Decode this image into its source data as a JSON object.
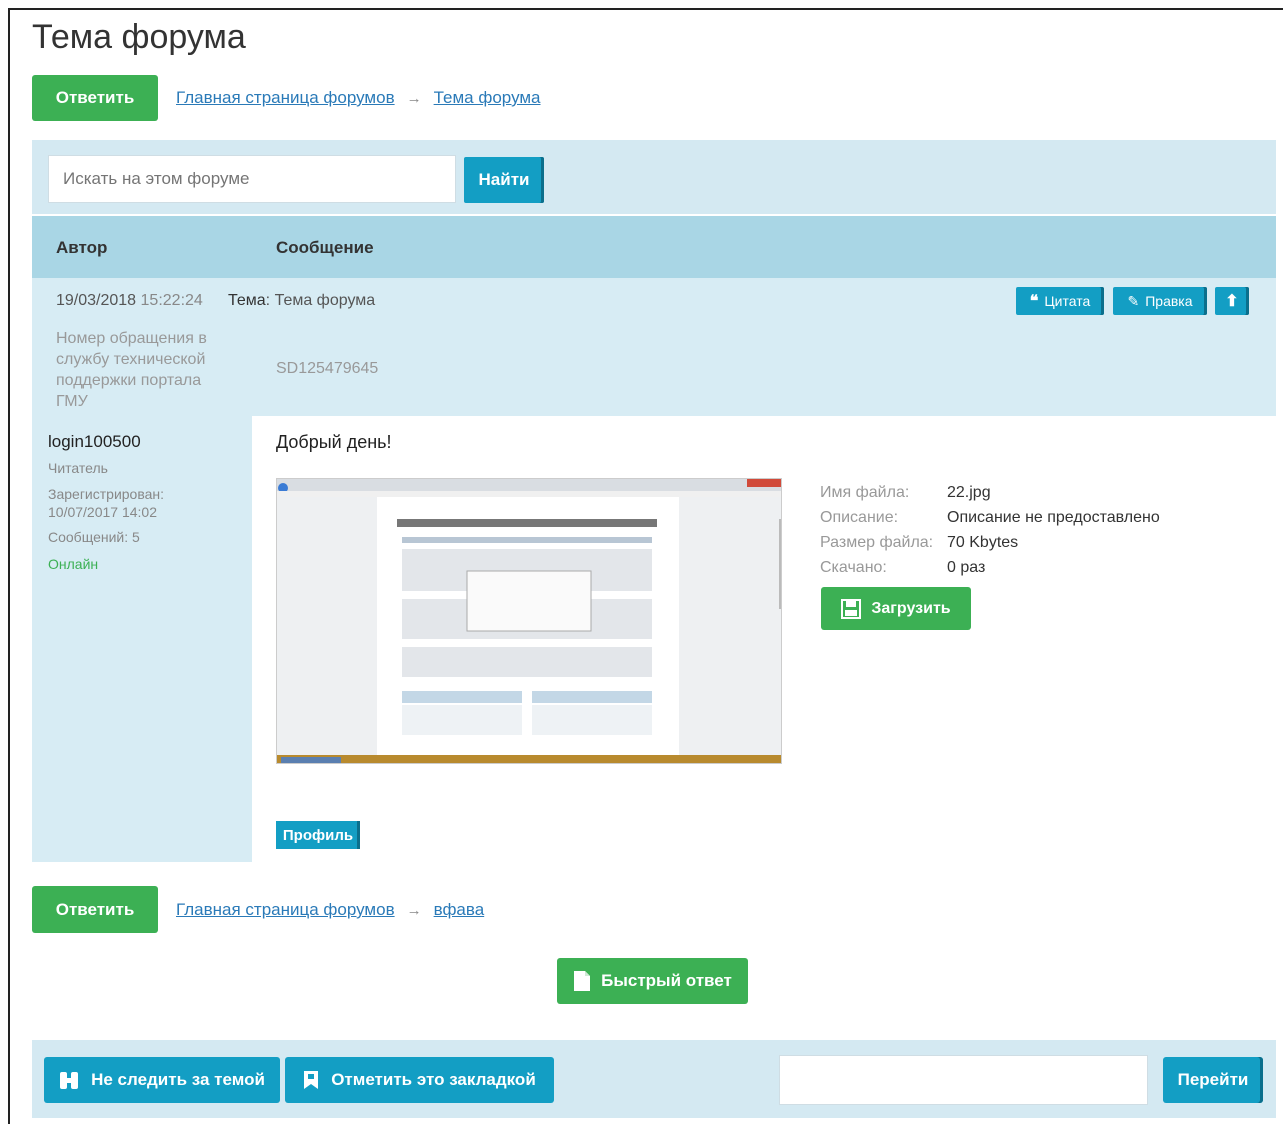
{
  "page": {
    "title": "Тема форума"
  },
  "top_nav": {
    "reply_label": "Ответить",
    "crumb_home": "Главная страница форумов",
    "crumb_topic": "Тема форума",
    "arrow": "→"
  },
  "search": {
    "placeholder": "Искать на этом форуме",
    "button": "Найти"
  },
  "table": {
    "col_author": "Автор",
    "col_message": "Сообщение"
  },
  "post_meta": {
    "date": "19/03/2018",
    "time": "15:22:24",
    "topic_label": "Тема",
    "topic_value": "Тема форума",
    "field_label": "Номер обращения в службу технической поддержки портала ГМУ",
    "field_value": "SD125479645",
    "quote_button": "Цитата",
    "edit_button": "Правка"
  },
  "author": {
    "name": "login100500",
    "rank": "Читатель",
    "registered": "Зарегистрирован: 10/07/2017 14:02",
    "posts": "Сообщений: 5",
    "status": "Онлайн"
  },
  "post": {
    "text": "Добрый день!",
    "attachment": {
      "name_label": "Имя файла:",
      "name_value": "22.jpg",
      "desc_label": "Описание:",
      "desc_value": "Описание не предоставлено",
      "size_label": "Размер файла:",
      "size_value": "70 Kbytes",
      "downloads_label": "Скачано:",
      "downloads_value": "0 раз",
      "download_button": "Загрузить"
    },
    "profile_button": "Профиль"
  },
  "bottom_nav": {
    "reply_label": "Ответить",
    "crumb_home": "Главная страница форумов",
    "crumb_topic": "вфава",
    "arrow": "→"
  },
  "quick_reply": "Быстрый ответ",
  "footer": {
    "unwatch": "Не следить за темой",
    "bookmark": "Отметить это закладкой",
    "jump_button": "Перейти"
  },
  "colors": {
    "green": "#3cb054",
    "teal": "#139ec4",
    "light_blue": "#d7ecf4",
    "header_blue": "#a9d6e5"
  }
}
